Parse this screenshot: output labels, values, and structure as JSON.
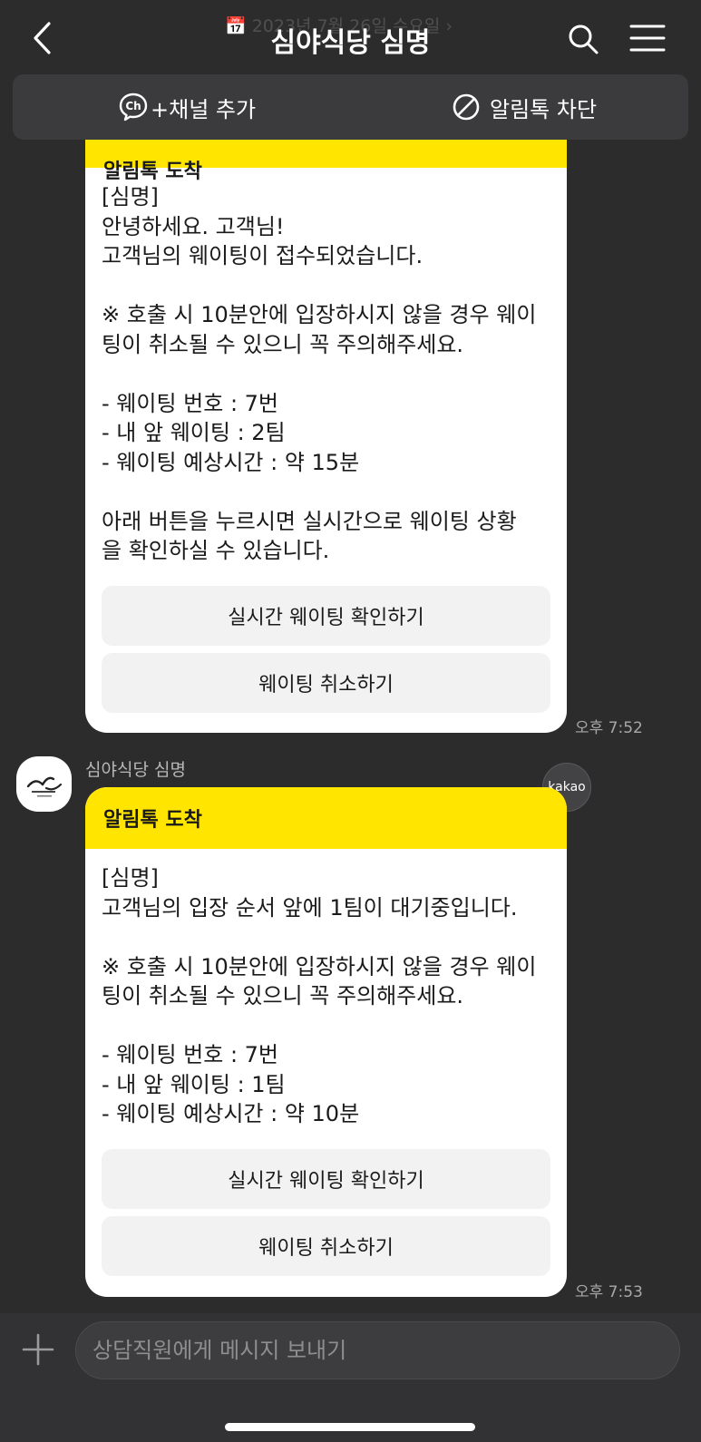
{
  "header": {
    "date_ghost": "📅 2023년 7월 26일 수요일 ›",
    "title": "심야식당 심명",
    "back_icon": "chevron-left-icon",
    "search_icon": "search-icon",
    "menu_icon": "hamburger-menu-icon"
  },
  "channel_bar": {
    "add_label": "+채널 추가",
    "block_label": "알림톡 차단"
  },
  "messages": [
    {
      "header": "알림톡 도착",
      "lines": [
        "[심명]",
        "안녕하세요. 고객님!",
        "고객님의 웨이팅이 접수되었습니다.",
        "",
        "※ 호출 시 10분안에 입장하시지 않을 경우 웨이",
        "팅이 취소될 수 있으니 꼭 주의해주세요.",
        "",
        "- 웨이팅 번호 : 7번",
        "- 내 앞 웨이팅 : 2팀",
        "- 웨이팅 예상시간 : 약 15분",
        "",
        "아래 버튼을 누르시면 실시간으로 웨이팅 상황",
        "을 확인하실 수 있습니다."
      ],
      "button1": "실시간 웨이팅 확인하기",
      "button2": "웨이팅 취소하기",
      "time": "오후 7:52"
    },
    {
      "sender": "심야식당 심명",
      "badge": "kakao",
      "header": "알림톡 도착",
      "lines": [
        "[심명]",
        "고객님의 입장 순서 앞에 1팀이 대기중입니다.",
        "",
        "※ 호출 시 10분안에 입장하시지 않을 경우 웨이",
        "팅이 취소될 수 있으니 꼭 주의해주세요.",
        "",
        "- 웨이팅 번호 : 7번",
        "- 내 앞 웨이팅 : 1팀",
        "- 웨이팅 예상시간 : 약 10분"
      ],
      "button1": "실시간 웨이팅 확인하기",
      "button2": "웨이팅 취소하기",
      "time": "오후 7:53"
    }
  ],
  "avatar_logo_text": "심명",
  "input": {
    "placeholder": "상담직원에게 메시지 보내기"
  }
}
